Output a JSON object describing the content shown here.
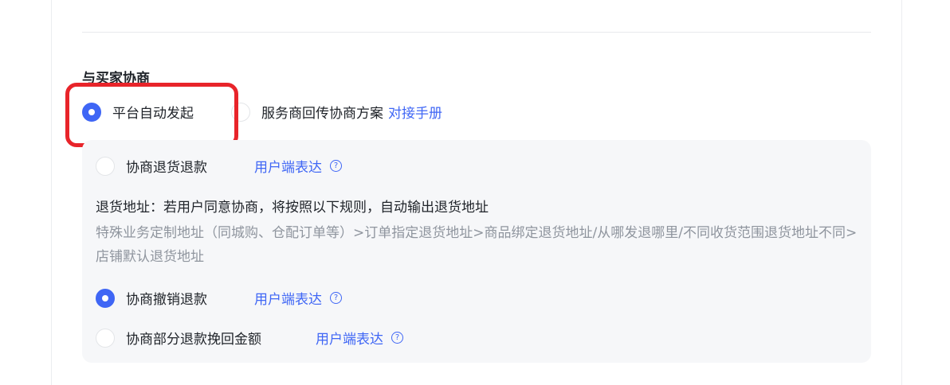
{
  "section": {
    "title": "与买家协商"
  },
  "mode": {
    "options": [
      {
        "label": "平台自动发起",
        "checked": true
      },
      {
        "label": "服务商回传协商方案",
        "checked": false
      }
    ],
    "manual_link": "对接手册"
  },
  "panel": {
    "items": [
      {
        "label": "协商退货退款",
        "checked": false,
        "link": "用户端表达"
      },
      {
        "label": "协商撤销退款",
        "checked": true,
        "link": "用户端表达"
      },
      {
        "label": "协商部分退款挽回金额",
        "checked": false,
        "link": "用户端表达"
      }
    ],
    "return_address": {
      "title": "退货地址：若用户同意协商，将按照以下规则，自动输出退货地址",
      "description": "特殊业务定制地址（同城购、仓配订单等）>订单指定退货地址>商品绑定退货地址/从哪发退哪里/不同收货范围退货地址不同>店铺默认退货地址"
    }
  },
  "colors": {
    "accent": "#3f66f5",
    "highlight": "#e8242a",
    "muted": "#8f959e",
    "panel_bg": "#f6f7f9"
  },
  "icons": {
    "help": "question-circle-icon"
  }
}
